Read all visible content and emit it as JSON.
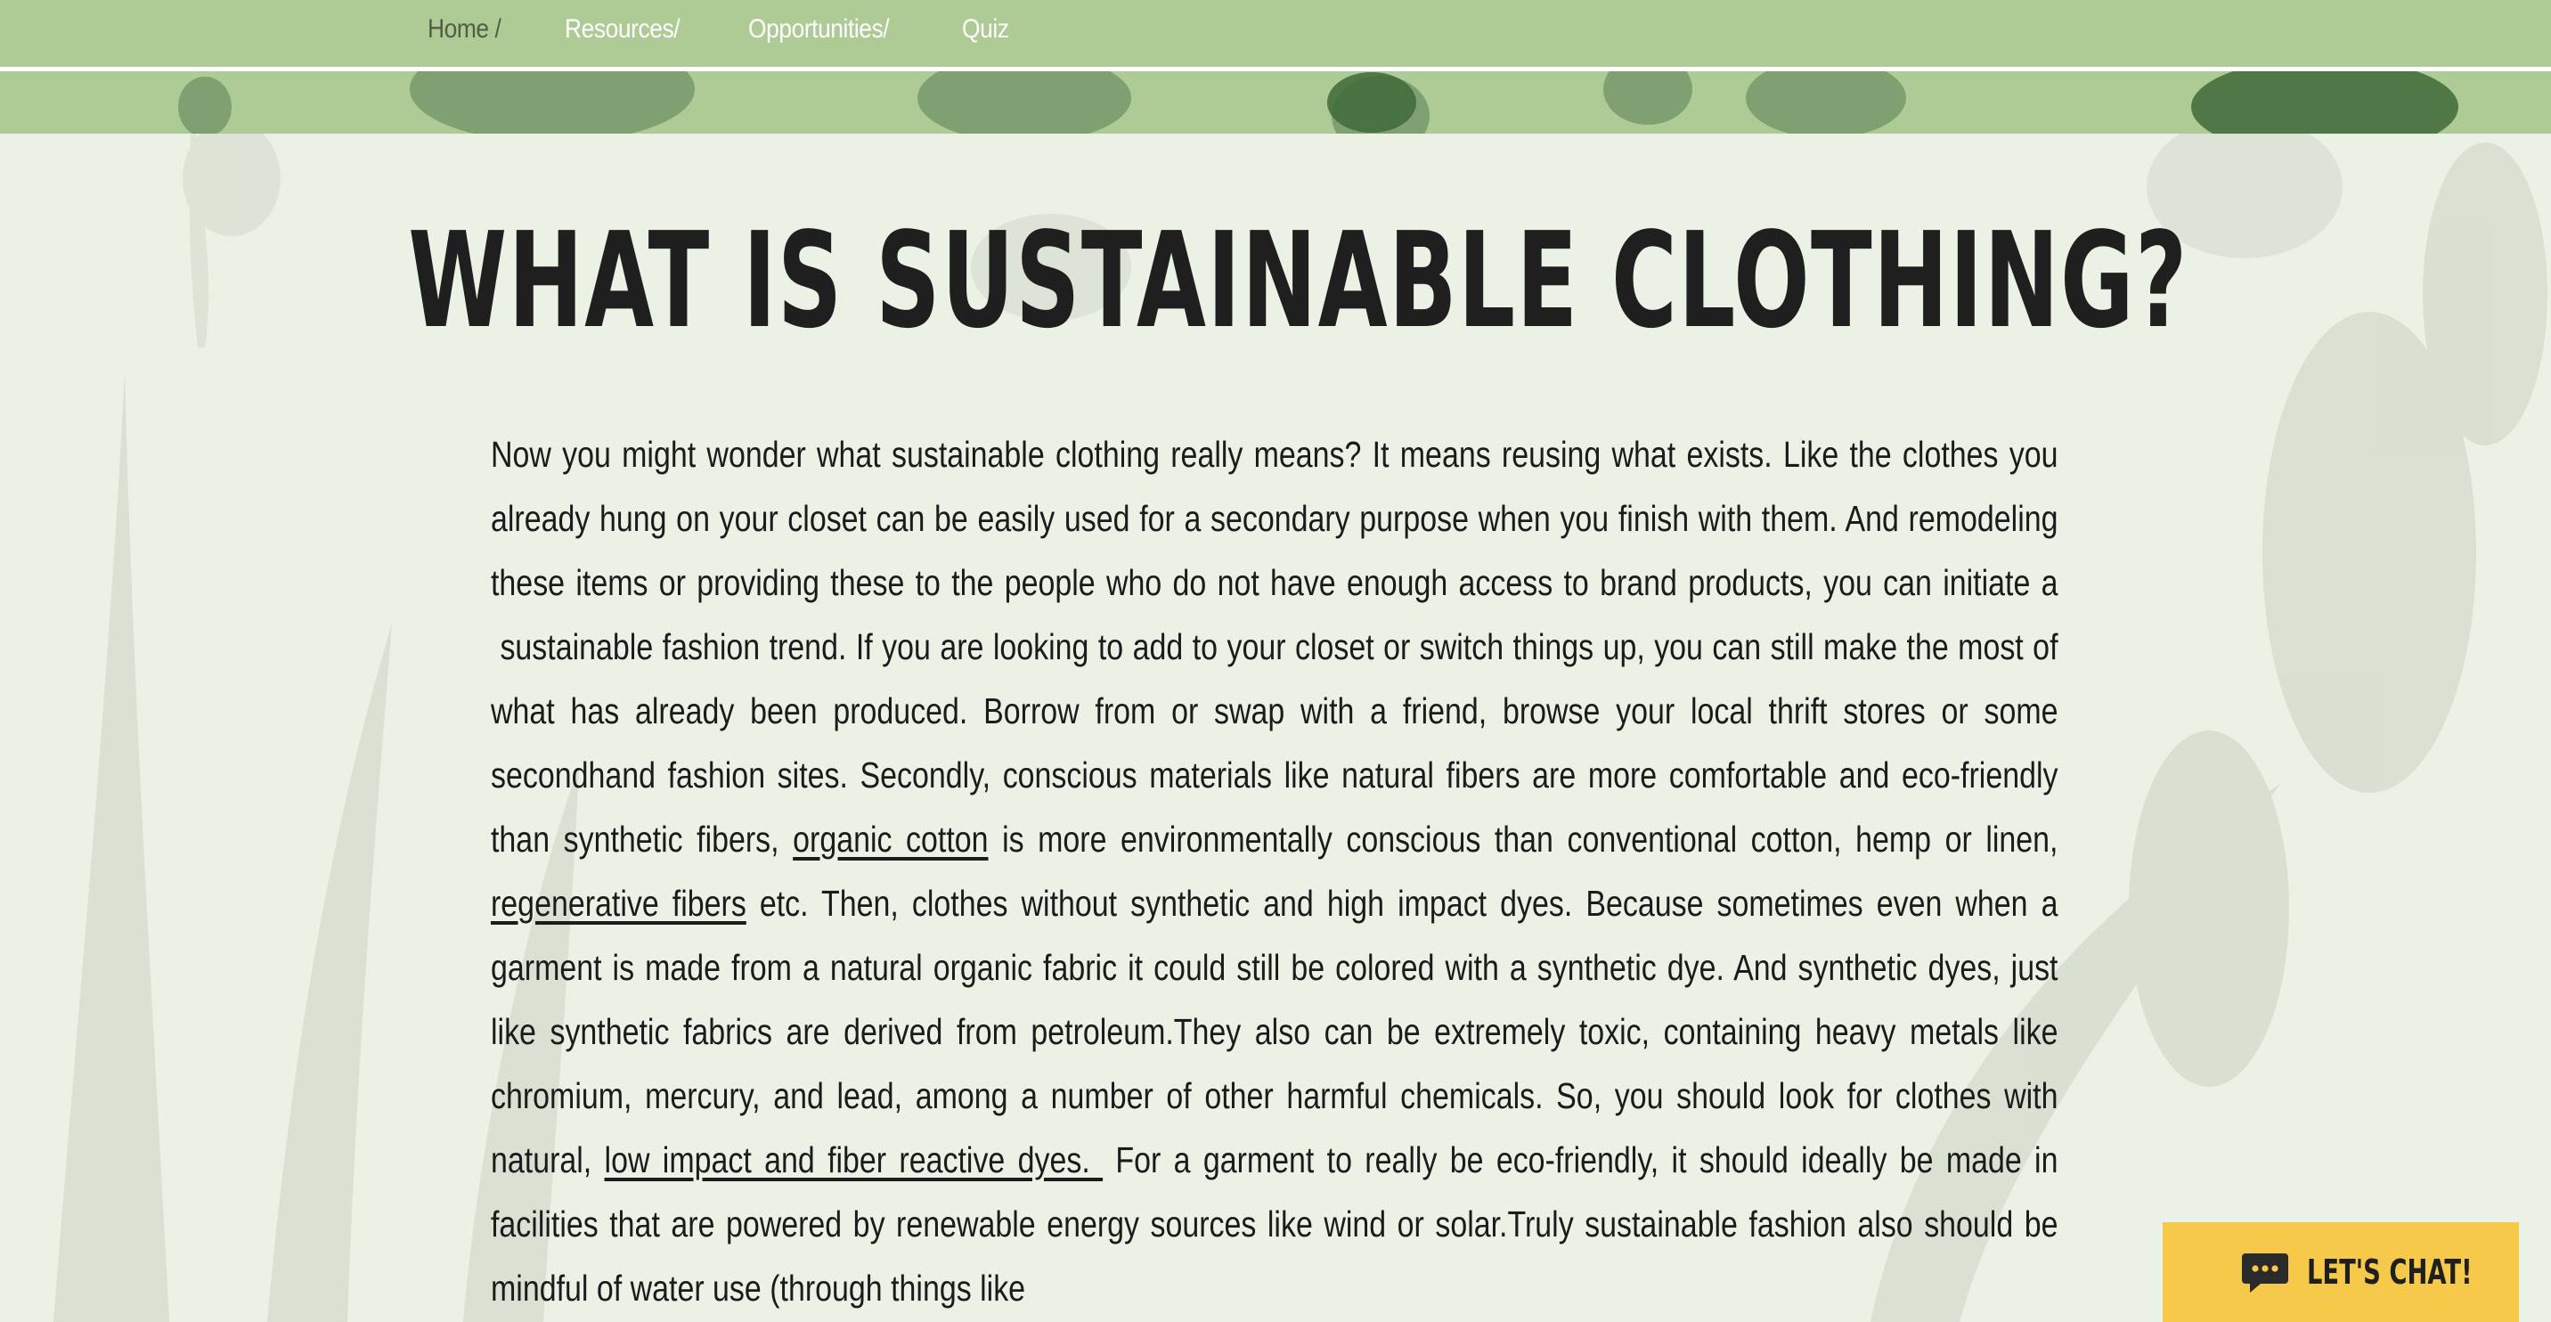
{
  "nav": {
    "items": [
      {
        "label": "Home /"
      },
      {
        "label": "Resources/"
      },
      {
        "label": "Opportunities/"
      },
      {
        "label": "Quiz"
      }
    ]
  },
  "page": {
    "title": "WHAT IS SUSTAINABLE CLOTHING?"
  },
  "body": {
    "seg1": "Now you might wonder what sustainable clothing really means? It means reusing what exists. Like the clothes you already hung on your closet can be easily used for a secondary purpose when you finish with them. And remodeling these items or providing these to the people who do not have enough access to brand products, you can initiate a  sustainable fashion trend. If you are looking to add to your closet or switch things up, you can still make the most of what has already been produced. Borrow from or swap with a friend, browse your local thrift stores or some secondhand fashion sites. Secondly, conscious materials like natural fibers are more comfortable and eco-friendly than synthetic fibers, ",
    "link1": "organic cotton",
    "seg2": " is more environmentally conscious than conventional cotton, hemp or linen, ",
    "link2": "regenerative fibers",
    "seg3": " etc. Then, clothes without synthetic and high impact dyes. Because sometimes even when a garment is made from a natural organic fabric it could still be colored with a synthetic dye. And synthetic dyes, just like synthetic fabrics are derived from petroleum.They also can be extremely toxic, containing heavy metals like chromium, mercury, and lead, among a number of other harmful chemicals. So, you should look for clothes with natural, ",
    "link3": "low impact and fiber reactive dyes. ",
    "seg4": " For a garment to really be eco-friendly, it should ideally be made in facilities that are powered by renewable energy sources like wind or solar.Truly sustainable fashion also should be mindful of water use (through things like"
  },
  "chat": {
    "label": "LET'S CHAT!",
    "icon": "chat-bubble-icon"
  },
  "colors": {
    "nav_background": "#aecb95",
    "page_background": "#ebf1e5",
    "chat_background": "#f6c94a",
    "text": "#1b1b1b"
  }
}
